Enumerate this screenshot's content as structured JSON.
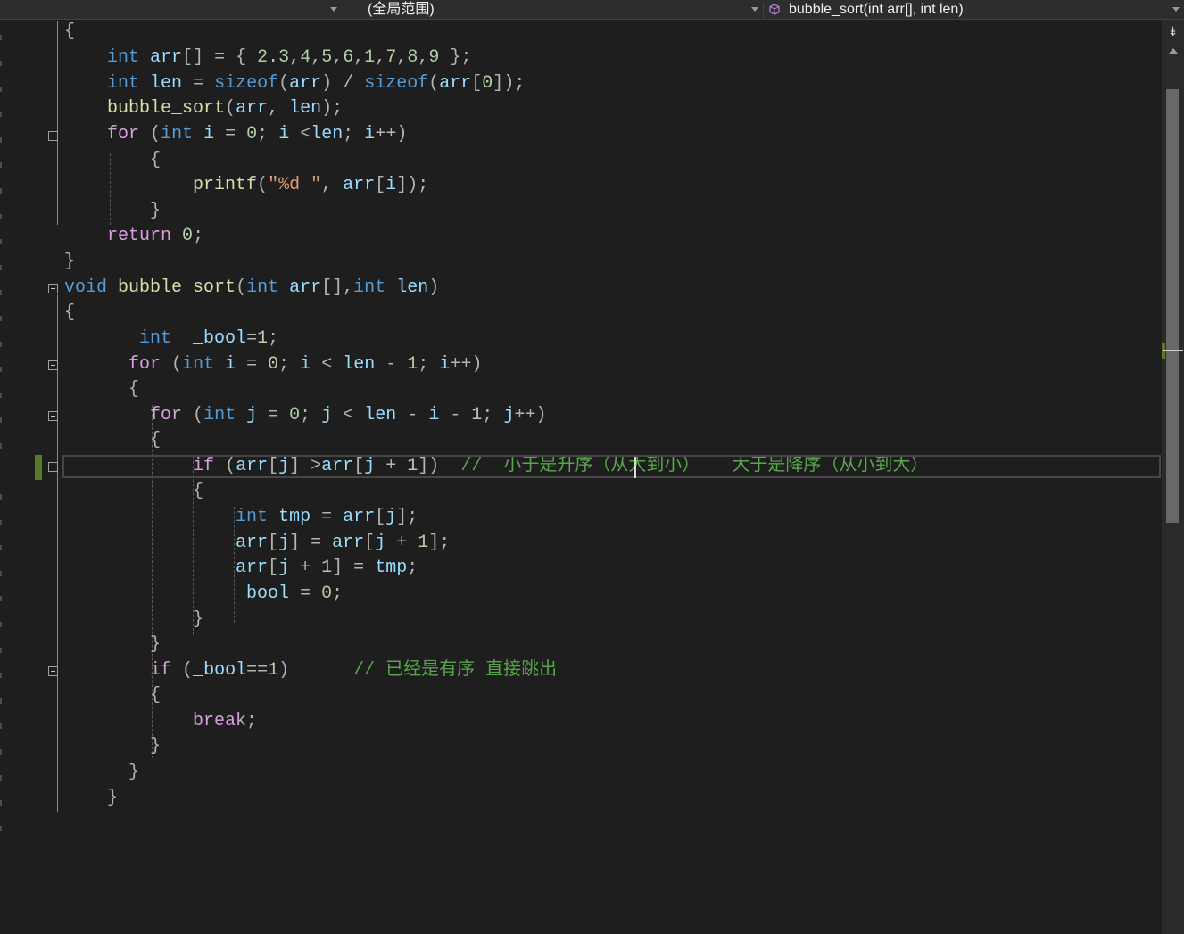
{
  "navbar": {
    "scope_label": "(全局范围)",
    "function_label": "bubble_sort(int arr[], int len)",
    "function_icon": "cube-icon"
  },
  "code": {
    "lines": [
      "{",
      "    int arr[] = { 2.3,4,5,6,1,7,8,9 };",
      "    int len = sizeof(arr) / sizeof(arr[0]);",
      "    bubble_sort(arr, len);",
      "    for (int i = 0; i <len; i++)",
      "        {",
      "            printf(\"%d \", arr[i]);",
      "        }",
      "    return 0;",
      "}",
      "void bubble_sort(int arr[],int len)",
      "{",
      "       int  _bool=1;",
      "      for (int i = 0; i < len - 1; i++)",
      "      {",
      "        for (int j = 0; j < len - i - 1; j++)",
      "        {",
      "            if (arr[j] >arr[j + 1])  //  小于是升序（从大到小）   大于是降序（从小到大）",
      "            {",
      "                int tmp = arr[j];",
      "                arr[j] = arr[j + 1];",
      "                arr[j + 1] = tmp;",
      "                _bool = 0;",
      "            }",
      "        }",
      "        if (_bool==1)      // 已经是有序 直接跳出",
      "        {",
      "            break;",
      "        }",
      "      }",
      "    }"
    ],
    "comment_sort_order": "//  小于是升序（从大到小）   大于是降序（从小到大）",
    "comment_break": "// 已经是有序 直接跳出"
  },
  "colors": {
    "background": "#1e1e1e",
    "keyword": "#569cd6",
    "control_keyword": "#d8a0df",
    "comment": "#57a64a",
    "number": "#b5cea8",
    "string": "#d69d85",
    "variable": "#9cdcfe",
    "function": "#dcdcaa"
  },
  "icons": [
    "split-icon",
    "scroll-up-icon",
    "fold-minus-icon"
  ]
}
